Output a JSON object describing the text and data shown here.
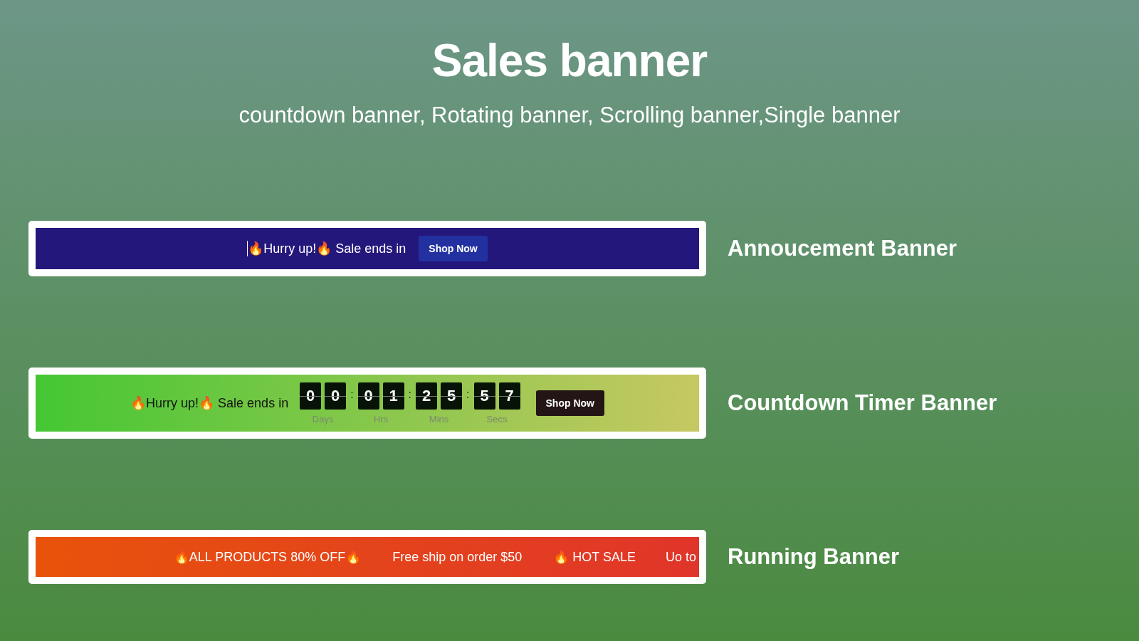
{
  "header": {
    "title": "Sales banner",
    "subtitle": "countdown banner, Rotating banner, Scrolling banner,Single banner"
  },
  "banners": [
    {
      "kind": "announcement",
      "caption": "Annoucement Banner",
      "message": "🔥Hurry up!🔥 Sale ends in",
      "button": "Shop Now"
    },
    {
      "kind": "countdown",
      "caption": "Countdown Timer Banner",
      "message": "🔥Hurry up!🔥 Sale ends in",
      "units": [
        {
          "digits": [
            "0",
            "0"
          ],
          "label": "Days"
        },
        {
          "digits": [
            "0",
            "1"
          ],
          "label": "Hrs"
        },
        {
          "digits": [
            "2",
            "5"
          ],
          "label": "Mins"
        },
        {
          "digits": [
            "5",
            "7"
          ],
          "label": "Secs"
        }
      ],
      "separator": ":",
      "button": "Shop Now"
    },
    {
      "kind": "running",
      "caption": "Running Banner",
      "items": [
        "🔥ALL PRODUCTS 80% OFF🔥",
        "Free ship on order $50",
        "🔥 HOT SALE",
        "Uo to"
      ]
    }
  ]
}
